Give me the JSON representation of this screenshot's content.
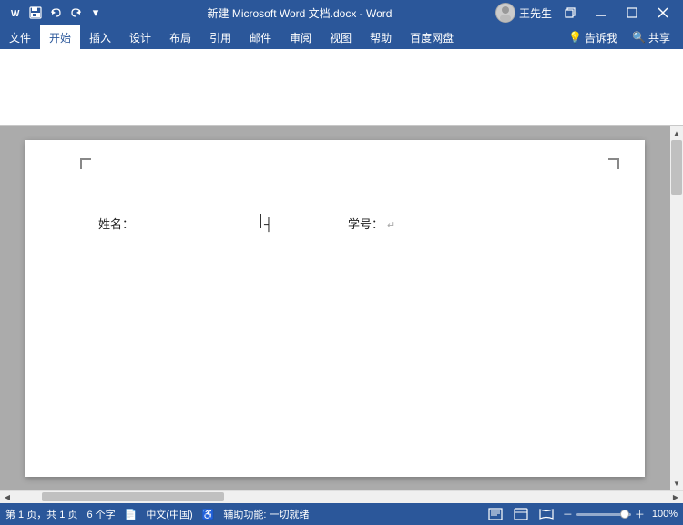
{
  "titlebar": {
    "title": "新建 Microsoft Word 文档.docx - Word",
    "user": "王先生",
    "qat": [
      "save",
      "undo",
      "redo",
      "customize"
    ],
    "window_btns": [
      "restore",
      "minimize",
      "maximize",
      "close"
    ]
  },
  "ribbon": {
    "tabs": [
      "文件",
      "开始",
      "插入",
      "设计",
      "布局",
      "引用",
      "邮件",
      "审阅",
      "视图",
      "帮助",
      "百度网盘"
    ],
    "active_tab": "开始",
    "right_btns": [
      "💡 告诉我",
      "🔍 共享"
    ]
  },
  "document": {
    "content_line1_label1": "姓名：",
    "content_line1_label2": "学号：",
    "enter_symbol": "↵"
  },
  "statusbar": {
    "page_info": "第 1 页，共 1 页",
    "word_count": "6 个字",
    "layout_icon": "📄",
    "lang": "中文(中国)",
    "accessibility": "辅助功能: 一切就绪",
    "zoom": "100%",
    "zoom_minus": "－",
    "zoom_plus": "＋"
  }
}
